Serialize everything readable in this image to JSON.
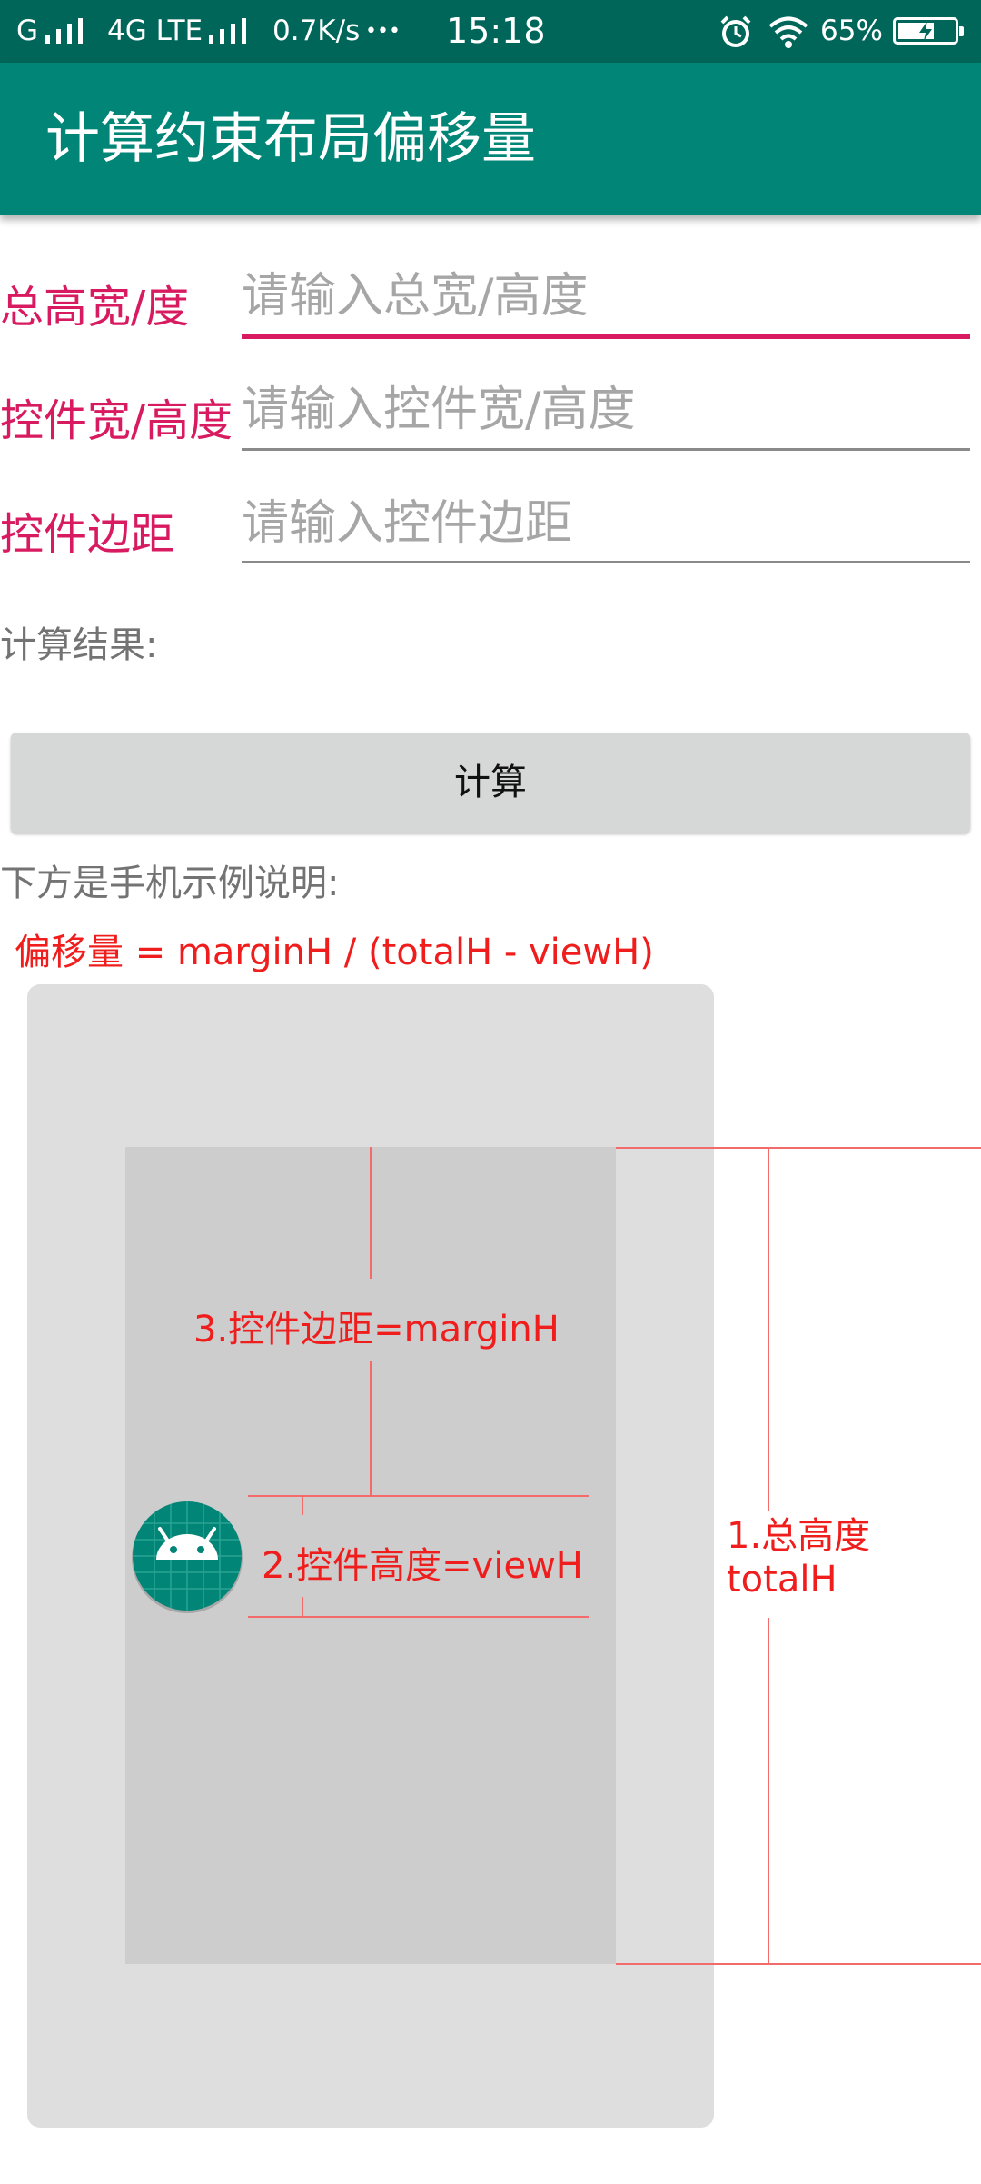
{
  "status_bar": {
    "carrier": "G",
    "network": "4G LTE",
    "speed": "0.7K/s",
    "dots": "•••",
    "time": "15:18",
    "battery_percent": "65%",
    "battery_level": 0.65,
    "icons": [
      "signal-icon",
      "alarm-icon",
      "wifi-icon",
      "battery-charging-icon"
    ]
  },
  "app_bar": {
    "title": "计算约束布局偏移量",
    "color": "#008577"
  },
  "form": {
    "total": {
      "label": "总高宽/度",
      "placeholder": "请输入总宽/高度"
    },
    "view": {
      "label": "控件宽/高度",
      "placeholder": "请输入控件宽/高度"
    },
    "margin": {
      "label": "控件边距",
      "placeholder": "请输入控件边距"
    }
  },
  "result_label": "计算结果:",
  "calc_button": "计算",
  "example_label": "下方是手机示例说明:",
  "formula": "偏移量 = marginH / (totalH - viewH)",
  "diagram": {
    "margin_label": "3.控件边距=marginH",
    "view_label": "2.控件高度=viewH",
    "total_label_line1": "1.总高度",
    "total_label_line2": "totalH",
    "icon": "android-icon",
    "accent": "#f01d1d"
  }
}
